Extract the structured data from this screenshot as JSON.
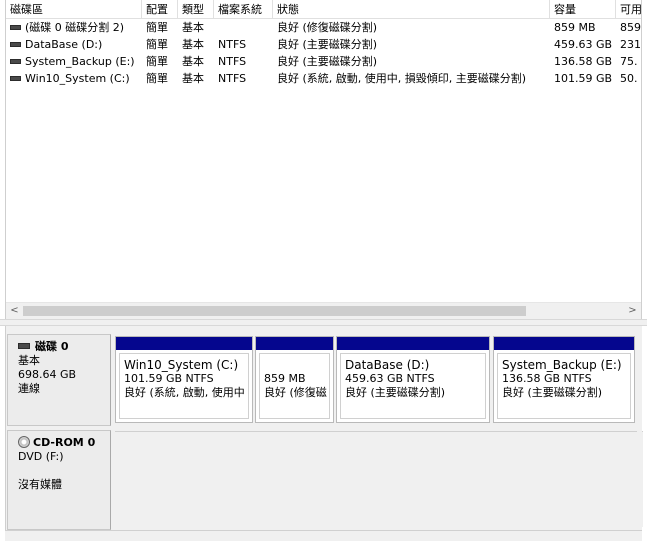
{
  "columns": [
    {
      "key": "volume",
      "label": "磁碟區"
    },
    {
      "key": "layout",
      "label": "配置"
    },
    {
      "key": "type",
      "label": "類型"
    },
    {
      "key": "fs",
      "label": "檔案系統"
    },
    {
      "key": "status",
      "label": "狀態"
    },
    {
      "key": "capacity",
      "label": "容量"
    },
    {
      "key": "free",
      "label": "可用"
    }
  ],
  "volumes": [
    {
      "volume": "(磁碟 0 磁碟分割 2)",
      "layout": "簡單",
      "type": "基本",
      "fs": "",
      "status": "良好 (修復磁碟分割)",
      "capacity": "859 MB",
      "free": "859"
    },
    {
      "volume": "DataBase (D:)",
      "layout": "簡單",
      "type": "基本",
      "fs": "NTFS",
      "status": "良好 (主要磁碟分割)",
      "capacity": "459.63 GB",
      "free": "231"
    },
    {
      "volume": "System_Backup (E:)",
      "layout": "簡單",
      "type": "基本",
      "fs": "NTFS",
      "status": "良好 (主要磁碟分割)",
      "capacity": "136.58 GB",
      "free": "75."
    },
    {
      "volume": "Win10_System (C:)",
      "layout": "簡單",
      "type": "基本",
      "fs": "NTFS",
      "status": "良好 (系統, 啟動, 使用中, 損毀傾印, 主要磁碟分割)",
      "capacity": "101.59 GB",
      "free": "50."
    }
  ],
  "scroll": {
    "left_arrow": "<",
    "right_arrow": ">"
  },
  "disk0": {
    "name": "磁碟 0",
    "kind": "基本",
    "size": "698.64 GB",
    "state": "連線",
    "partitions": [
      {
        "name": "Win10_System  (C:)",
        "size": "101.59 GB NTFS",
        "status": "良好 (系統, 啟動, 使用中"
      },
      {
        "name": "",
        "size": "859 MB",
        "status": "良好 (修復磁"
      },
      {
        "name": "DataBase  (D:)",
        "size": "459.63 GB NTFS",
        "status": "良好 (主要磁碟分割)"
      },
      {
        "name": "System_Backup  (E:)",
        "size": "136.58 GB NTFS",
        "status": "良好 (主要磁碟分割)"
      }
    ]
  },
  "cdrom0": {
    "name": "CD-ROM 0",
    "drive": "DVD (F:)",
    "media": "沒有媒體"
  },
  "colors": {
    "partition_bar": "#05068e",
    "pane_bg": "#f0f0f0"
  }
}
